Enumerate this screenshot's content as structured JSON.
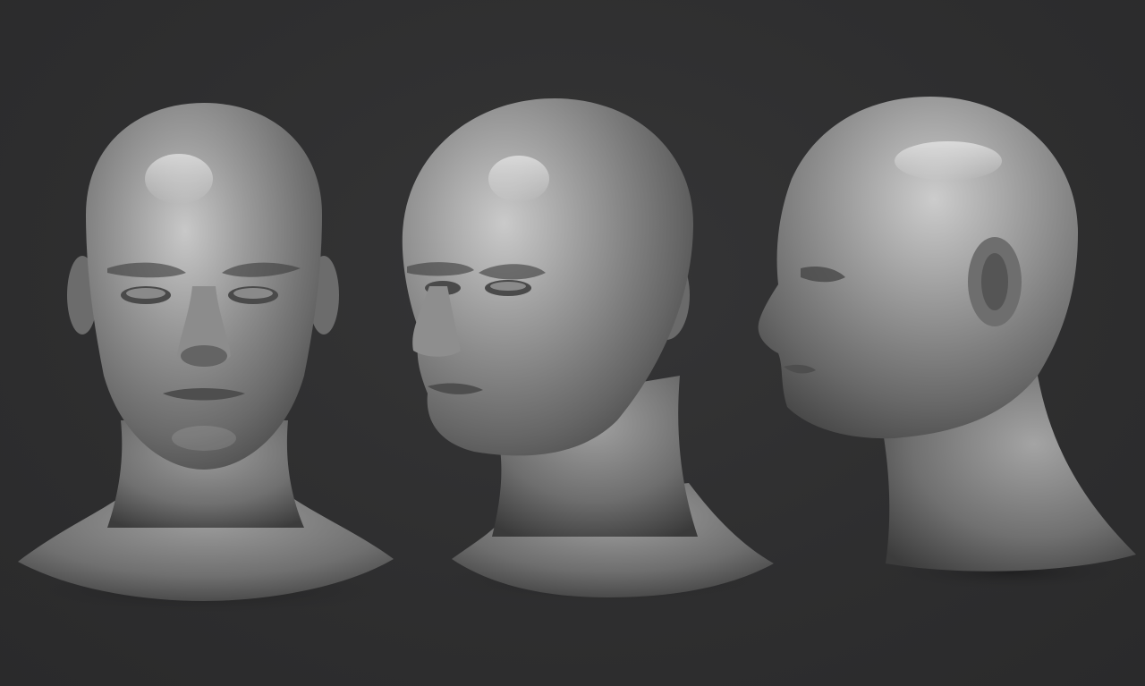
{
  "scene": {
    "background_color": "#2f2f30",
    "material_color": "#8a8a8a",
    "busts": [
      {
        "view": "front"
      },
      {
        "view": "three-quarter"
      },
      {
        "view": "profile"
      }
    ]
  }
}
